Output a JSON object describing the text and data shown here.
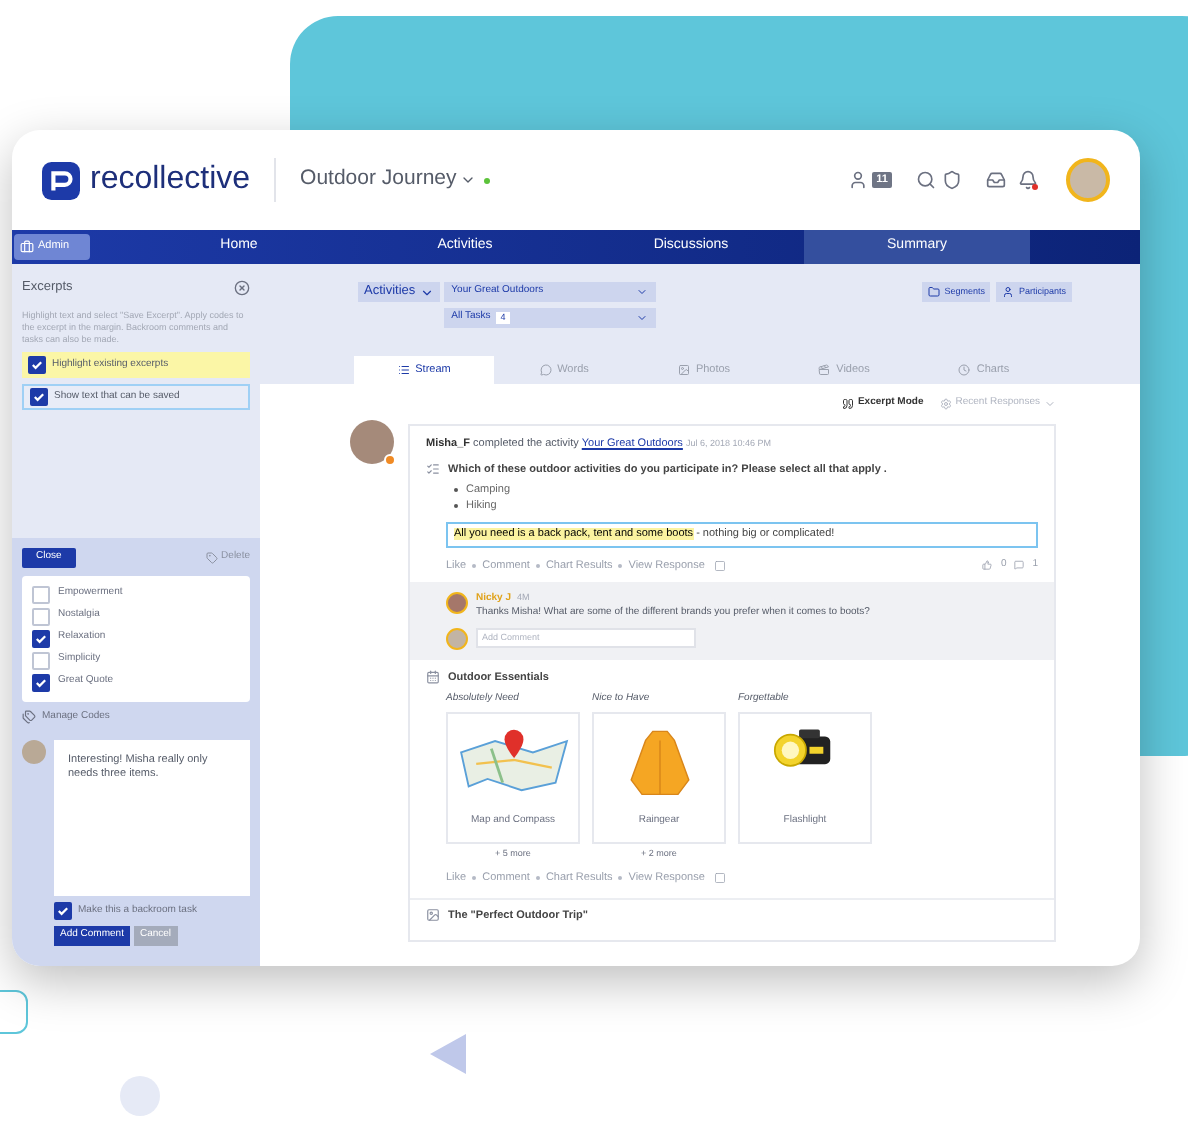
{
  "brand": {
    "name": "recollective"
  },
  "project": {
    "name": "Outdoor Journey",
    "online": true
  },
  "header": {
    "participants_count": "11",
    "notifications_unread": true
  },
  "nav": {
    "admin": "Admin",
    "tabs": [
      {
        "label": "Home",
        "selected": false
      },
      {
        "label": "Activities",
        "selected": false
      },
      {
        "label": "Discussions",
        "selected": false
      },
      {
        "label": "Summary",
        "selected": true
      }
    ]
  },
  "sidebar": {
    "title": "Excerpts",
    "hint": "Highlight text and select \"Save Excerpt\". Apply codes to the excerpt in the margin. Backroom comments and tasks can also be made.",
    "options": [
      {
        "label": "Highlight existing excerpts",
        "checked": true,
        "highlighted": true
      },
      {
        "label": "Show text that can be saved",
        "checked": true,
        "highlighted": false
      }
    ]
  },
  "excerpt_panel": {
    "close": "Close",
    "delete": "Delete",
    "codes": [
      {
        "label": "Empowerment",
        "checked": false
      },
      {
        "label": "Nostalgia",
        "checked": false
      },
      {
        "label": "Relaxation",
        "checked": true
      },
      {
        "label": "Simplicity",
        "checked": false
      },
      {
        "label": "Great Quote",
        "checked": true
      }
    ],
    "manage": "Manage Codes",
    "comment": "Interesting! Misha really only needs three items.",
    "backroom_task": {
      "label": "Make this a backroom task",
      "checked": true
    },
    "buttons": [
      "Add Comment",
      "Cancel"
    ]
  },
  "filters": {
    "scope": "Activities",
    "activity": "Your Great Outdoors",
    "tasks": "All Tasks",
    "tasks_count": "4",
    "buttons": [
      {
        "label": "Segments",
        "kind": "segments"
      },
      {
        "label": "Participants",
        "kind": "participants"
      }
    ]
  },
  "views": [
    {
      "label": "Stream",
      "kind": "stream",
      "selected": true
    },
    {
      "label": "Words",
      "kind": "words",
      "selected": false
    },
    {
      "label": "Photos",
      "kind": "photos",
      "selected": false
    },
    {
      "label": "Videos",
      "kind": "videos",
      "selected": false
    },
    {
      "label": "Charts",
      "kind": "charts",
      "selected": false
    }
  ],
  "toolbar": {
    "excerpt_mode": "Excerpt Mode",
    "sort": "Recent Responses"
  },
  "post": {
    "author": "Misha_F",
    "action": "completed the activity",
    "activity": "Your Great Outdoors",
    "time": "Jul 6, 2018 10:46 PM",
    "question": "Which of these outdoor activities do you participate in? Please select all that apply .",
    "answers": [
      "Camping",
      "Hiking"
    ],
    "response_highlight": "All you need is a back pack, tent and some boots",
    "response_rest": " - nothing big or complicated!",
    "actions": [
      "Like",
      "Comment",
      "Chart Results",
      "View Response"
    ],
    "likes": "0",
    "comments": "1",
    "reply": {
      "author": "Nicky J",
      "age": "4M",
      "text": "Thanks Misha! What are some of the different brands you prefer when it comes to boots?"
    },
    "comment_placeholder": "Add Comment"
  },
  "sort_task": {
    "title": "Outdoor Essentials",
    "groups": [
      {
        "label": "Absolutely Need",
        "item": "Map and Compass",
        "more": "+ 5 more",
        "kind": "map"
      },
      {
        "label": "Nice to Have",
        "item": "Raingear",
        "more": "+ 2 more",
        "kind": "raincoat"
      },
      {
        "label": "Forgettable",
        "item": "Flashlight",
        "kind": "flashlight"
      }
    ],
    "actions": [
      "Like",
      "Comment",
      "Chart Results",
      "View Response"
    ]
  },
  "next_task": {
    "title": "The \"Perfect Outdoor Trip\""
  }
}
